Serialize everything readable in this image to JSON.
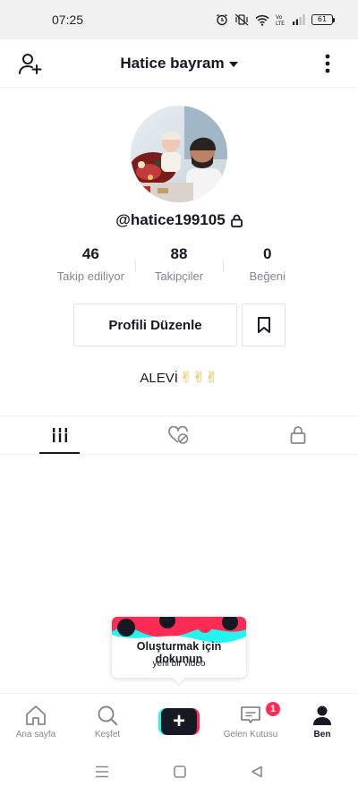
{
  "status_bar": {
    "time": "07:25",
    "battery": "61",
    "icons": [
      "alarm-icon",
      "vibrate-icon",
      "wifi-icon",
      "volte-icon",
      "signal-icon",
      "battery-icon"
    ]
  },
  "header": {
    "title": "Hatice bayram",
    "left_icon": "add-user-icon",
    "right_icon": "more-vertical-icon"
  },
  "profile": {
    "username": "@hatice199105",
    "private": true,
    "stats": [
      {
        "value": "46",
        "label": "Takip ediliyor"
      },
      {
        "value": "88",
        "label": "Takipçiler"
      },
      {
        "value": "0",
        "label": "Beğeni"
      }
    ],
    "edit_button": "Profili Düzenle",
    "bio_text": "ALEVİ",
    "bio_emoji": "✌✌✌"
  },
  "tabs": [
    {
      "icon": "videos-grid-icon",
      "active": true
    },
    {
      "icon": "liked-hidden-icon",
      "active": false
    },
    {
      "icon": "lock-icon",
      "active": false
    }
  ],
  "tooltip": {
    "title": "Oluşturmak için dokunun",
    "subtitle": "yeni bir video"
  },
  "bottom_nav": {
    "items": [
      {
        "label": "Ana sayfa",
        "icon": "home-icon"
      },
      {
        "label": "Keşfet",
        "icon": "search-icon"
      },
      {
        "label": "",
        "icon": "create-plus-icon"
      },
      {
        "label": "Gelen Kutusu",
        "icon": "inbox-icon",
        "badge": "1"
      },
      {
        "label": "Ben",
        "icon": "profile-icon",
        "active": true
      }
    ]
  },
  "colors": {
    "accent_red": "#fe2c55",
    "accent_cyan": "#25f4ee",
    "text_primary": "#161823",
    "text_secondary": "#86878b"
  }
}
